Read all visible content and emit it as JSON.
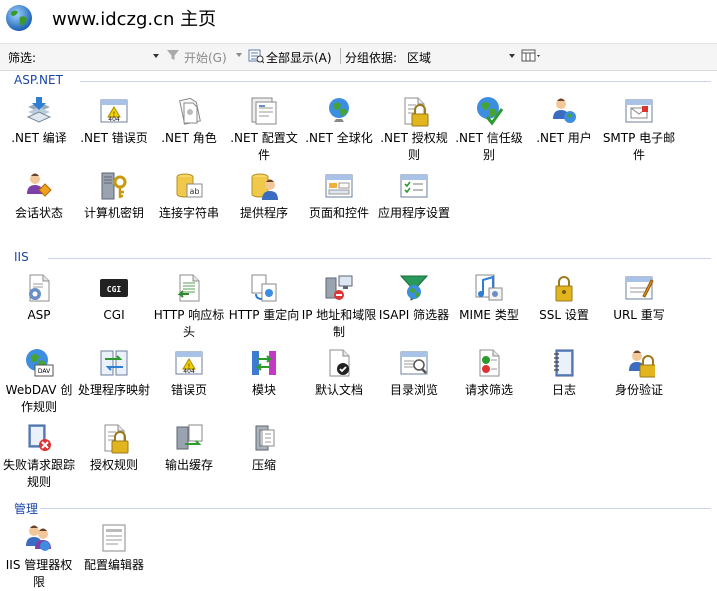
{
  "header": {
    "title": "www.idczg.cn 主页"
  },
  "toolbar": {
    "filter_label": "筛选:",
    "start_label": "开始(G)",
    "show_all_label": "全部显示(A)",
    "group_by_label": "分组依据:",
    "group_by_value": "区域"
  },
  "sections": [
    {
      "name": "ASP.NET",
      "items": [
        {
          "label": ".NET 编译",
          "icon": "net-compile-icon"
        },
        {
          "label": ".NET 错误页",
          "icon": "net-error-page-icon"
        },
        {
          "label": ".NET 角色",
          "icon": "net-roles-icon"
        },
        {
          "label": ".NET 配置文件",
          "icon": "net-profile-icon"
        },
        {
          "label": ".NET 全球化",
          "icon": "net-globalization-icon"
        },
        {
          "label": ".NET 授权规则",
          "icon": "net-authorization-icon"
        },
        {
          "label": ".NET 信任级别",
          "icon": "net-trust-levels-icon"
        },
        {
          "label": ".NET 用户",
          "icon": "net-users-icon"
        },
        {
          "label": "SMTP 电子邮件",
          "icon": "smtp-email-icon"
        },
        {
          "label": "会话状态",
          "icon": "session-state-icon"
        },
        {
          "label": "计算机密钥",
          "icon": "machine-key-icon"
        },
        {
          "label": "连接字符串",
          "icon": "connection-strings-icon"
        },
        {
          "label": "提供程序",
          "icon": "providers-icon"
        },
        {
          "label": "页面和控件",
          "icon": "pages-controls-icon"
        },
        {
          "label": "应用程序设置",
          "icon": "app-settings-icon"
        }
      ]
    },
    {
      "name": "IIS",
      "items": [
        {
          "label": "ASP",
          "icon": "asp-icon"
        },
        {
          "label": "CGI",
          "icon": "cgi-icon"
        },
        {
          "label": "HTTP 响应标头",
          "icon": "http-headers-icon"
        },
        {
          "label": "HTTP 重定向",
          "icon": "http-redirect-icon"
        },
        {
          "label": "IP 地址和域限制",
          "icon": "ip-restrictions-icon"
        },
        {
          "label": "ISAPI 筛选器",
          "icon": "isapi-filters-icon"
        },
        {
          "label": "MIME 类型",
          "icon": "mime-types-icon"
        },
        {
          "label": "SSL 设置",
          "icon": "ssl-settings-icon"
        },
        {
          "label": "URL 重写",
          "icon": "url-rewrite-icon"
        },
        {
          "label": "WebDAV 创作规则",
          "icon": "webdav-icon"
        },
        {
          "label": "处理程序映射",
          "icon": "handler-mappings-icon"
        },
        {
          "label": "错误页",
          "icon": "error-pages-icon"
        },
        {
          "label": "模块",
          "icon": "modules-icon"
        },
        {
          "label": "默认文档",
          "icon": "default-document-icon"
        },
        {
          "label": "目录浏览",
          "icon": "directory-browsing-icon"
        },
        {
          "label": "请求筛选",
          "icon": "request-filtering-icon"
        },
        {
          "label": "日志",
          "icon": "logging-icon"
        },
        {
          "label": "身份验证",
          "icon": "authentication-icon"
        },
        {
          "label": "失败请求跟踪规则",
          "icon": "failed-request-tracing-icon"
        },
        {
          "label": "授权规则",
          "icon": "authorization-rules-icon"
        },
        {
          "label": "输出缓存",
          "icon": "output-caching-icon"
        },
        {
          "label": "压缩",
          "icon": "compression-icon"
        }
      ]
    },
    {
      "name": "管理",
      "items": [
        {
          "label": "IIS 管理器权限",
          "icon": "iis-manager-permissions-icon"
        },
        {
          "label": "配置编辑器",
          "icon": "configuration-editor-icon"
        }
      ]
    }
  ]
}
